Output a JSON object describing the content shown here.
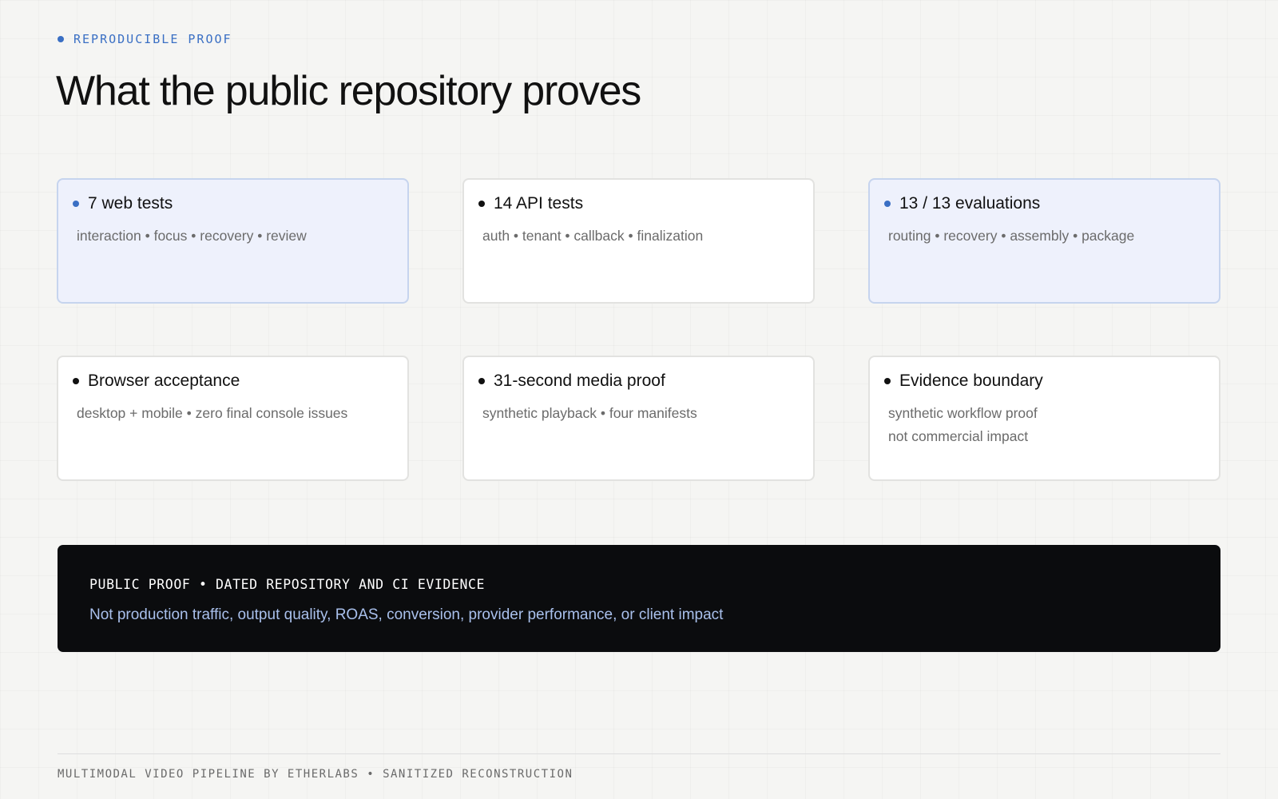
{
  "eyebrow": "REPRODUCIBLE PROOF",
  "title": "What the public repository proves",
  "cards": [
    {
      "title": "7 web tests",
      "lines": [
        "interaction • focus • recovery • review"
      ],
      "accent": true
    },
    {
      "title": "14 API tests",
      "lines": [
        "auth • tenant • callback • finalization"
      ],
      "accent": false
    },
    {
      "title": "13 / 13 evaluations",
      "lines": [
        "routing • recovery • assembly • package"
      ],
      "accent": true
    },
    {
      "title": "Browser acceptance",
      "lines": [
        "desktop + mobile • zero final console issues"
      ],
      "accent": false
    },
    {
      "title": "31-second media proof",
      "lines": [
        "synthetic playback • four manifests"
      ],
      "accent": false
    },
    {
      "title": "Evidence boundary",
      "lines": [
        "synthetic workflow proof",
        "not commercial impact"
      ],
      "accent": false
    }
  ],
  "banner": {
    "heading": "PUBLIC PROOF • DATED REPOSITORY AND CI EVIDENCE",
    "text": "Not production traffic, output quality, ROAS, conversion, provider performance, or client impact"
  },
  "footer": "MULTIMODAL VIDEO PIPELINE BY ETHERLABS • SANITIZED RECONSTRUCTION",
  "colors": {
    "accent": "#3a6fc4",
    "accent_card_bg": "#eef1fc",
    "banner_bg": "#0b0c0e",
    "banner_text": "#a9c0ec"
  }
}
